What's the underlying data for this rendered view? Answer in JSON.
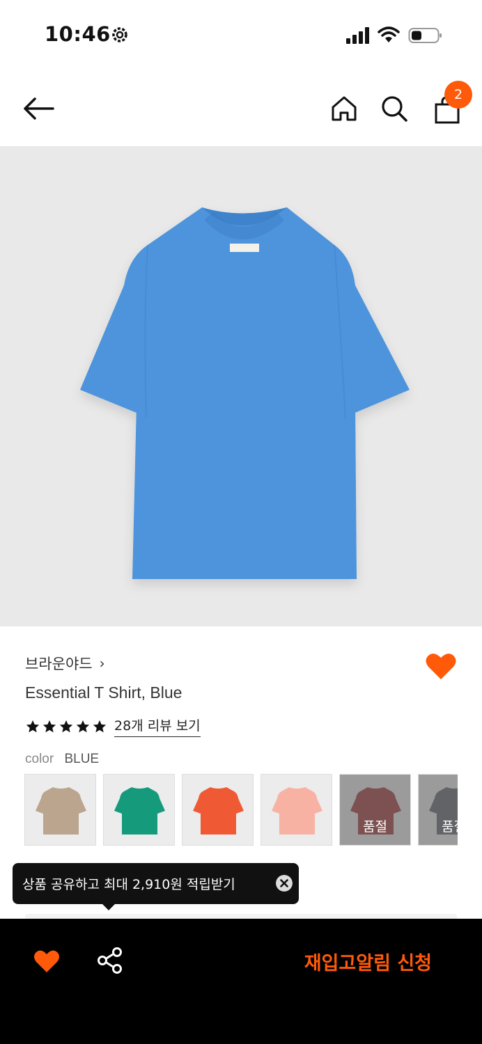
{
  "status_bar": {
    "time": "10:46",
    "icons": [
      "gear-icon",
      "signal-icon",
      "wifi-icon",
      "battery-icon"
    ]
  },
  "header": {
    "icons": [
      "back-arrow-icon",
      "home-icon",
      "search-icon",
      "shopping-bag-icon"
    ],
    "cart_count": "2"
  },
  "product": {
    "image_color": "#4e94dc",
    "brand": "브라운야드",
    "brand_chevron": "›",
    "name": "Essential T Shirt, Blue",
    "rating_stars": 5,
    "review_link": "28개 리뷰 보기",
    "color_label": "color",
    "color_value": "BLUE",
    "wishlisted": true
  },
  "swatches": [
    {
      "color": "#bba58f",
      "sold_out": false,
      "sold_label": ""
    },
    {
      "color": "#169a7c",
      "sold_out": false,
      "sold_label": ""
    },
    {
      "color": "#ef5a35",
      "sold_out": false,
      "sold_label": ""
    },
    {
      "color": "#f8b2a4",
      "sold_out": false,
      "sold_label": ""
    },
    {
      "color": "#a8474a",
      "sold_out": true,
      "sold_label": "품절"
    },
    {
      "color": "#6b6f75",
      "sold_out": true,
      "sold_label": "품절"
    }
  ],
  "tooltip": {
    "text": "상품 공유하고 최대 2,910원 적립받기"
  },
  "bottom_bar": {
    "restock_label": "재입고알림 신청"
  },
  "colors": {
    "accent": "#ff5a0a",
    "bottom_bar_bg": "#000000",
    "image_bg": "#e9e9e9"
  }
}
